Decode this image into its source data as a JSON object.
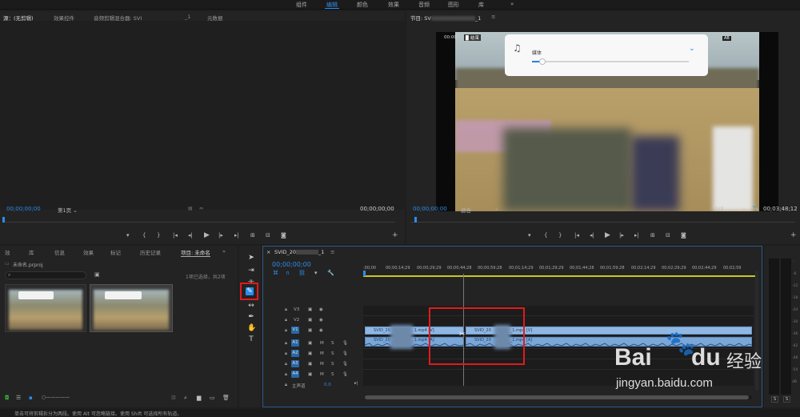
{
  "workspaces": [
    "组件",
    "编辑",
    "颜色",
    "效果",
    "音频",
    "图形",
    "库",
    "»"
  ],
  "source_panel": {
    "tabs": [
      "源：(无剪辑)",
      "效果控件",
      "音频剪辑混合器: SVI",
      "_1",
      "元数据"
    ],
    "timecode_left": "00;00;00;00",
    "page_select": "第1页",
    "timecode_right": "00;00;00;00"
  },
  "program_panel": {
    "tab": "节目: SV",
    "tab_suffix": "_1",
    "overlay_time": "00:00",
    "overlay_tag": "▉ 结束",
    "badge": "AB",
    "volume_label": "媒体",
    "timecode_left": "00;00;00;00",
    "fit_select": "适合",
    "ratio_select": "1/2",
    "timecode_right": "00;03;48;12"
  },
  "project_panel": {
    "tabs": [
      "效",
      "库",
      "信息",
      "效果",
      "标记",
      "历史记录",
      "项目: 未命名"
    ],
    "project_file": "未命名.prproj",
    "search_placeholder": "",
    "selection_info": "1项已选择，共2项"
  },
  "timeline": {
    "sequence_name": "SVID_20",
    "sequence_suffix": "_1",
    "current_time": "00;00;00;00",
    "ruler_labels": [
      ":00;00",
      "00;00;14;29",
      "00;00;29;29",
      "00;00;44;28",
      "00;00;59;28",
      "00;01;14;29",
      "00;01;29;29",
      "00;01;44;28",
      "00;01;59;28",
      "00;02;14;29",
      "00;02;29;29",
      "00;02;44;29",
      "00;02;59"
    ],
    "video_tracks": [
      "V3",
      "V2",
      "V1"
    ],
    "audio_tracks": [
      "A1",
      "A2",
      "A3",
      "A4"
    ],
    "master_label": "主声道",
    "master_value": "0.0",
    "clip_left_label": "SVID_20",
    "clip_left_ext": "1.mp4 [V]",
    "clip_right_label": "SVID_20",
    "clip_right_ext": "_1.mp4 [V]",
    "aclip_left_label": "SVID_20",
    "aclip_left_ext": "1.mp4 [A]",
    "aclip_right_label": "SVID_20",
    "aclip_right_ext": "_1.mp4 [A]"
  },
  "meter": {
    "labels": [
      "-",
      "-6",
      "-12",
      "-18",
      "-24",
      "-30",
      "-36",
      "-42",
      "-48",
      "-54",
      "dB"
    ],
    "solo": [
      "S",
      "S"
    ]
  },
  "status_bar": "单击可将剪辑拆分为两段。使用 Alt 可忽略链接。使用 Shift 可选择所有轨道。",
  "watermark": {
    "brand_a": "Bai",
    "brand_b": "du",
    "brand_cn": "经验",
    "url": "jingyan.baidu.com"
  }
}
